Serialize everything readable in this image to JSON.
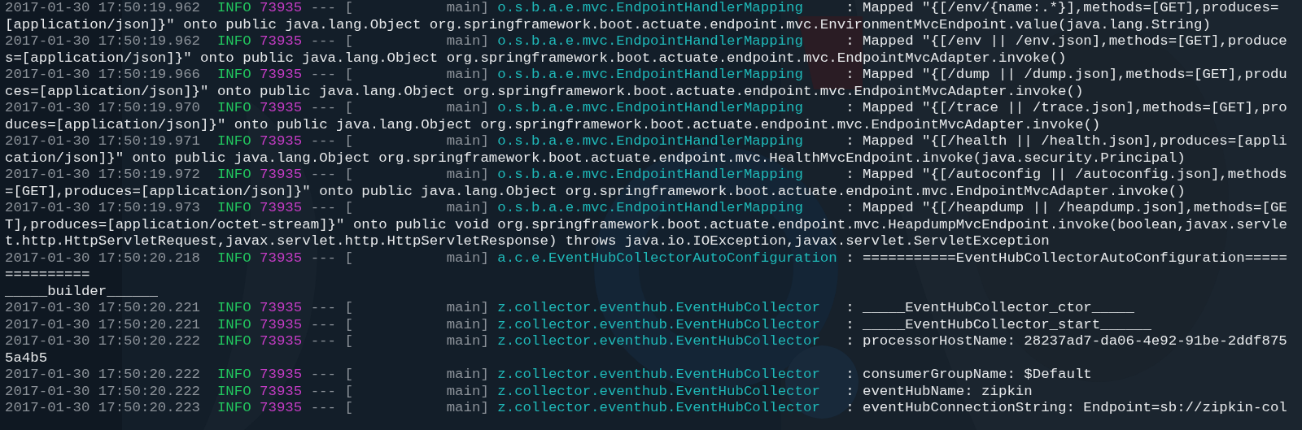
{
  "terminal": {
    "lines": [
      {
        "kind": "log",
        "timestamp": "2017-01-30 17:50:19.962",
        "level": "INFO",
        "pid": "73935",
        "thread": "--- [           main]",
        "logger": "o.s.b.a.e.mvc.EndpointHandlerMapping",
        "message": ": Mapped \"{[/env/{name:.*}],methods=[GET],produces=[application/json]}\" onto public java.lang.Object org.springframework.boot.actuate.endpoint.mvc.EnvironmentMvcEndpoint.value(java.lang.String)"
      },
      {
        "kind": "log",
        "timestamp": "2017-01-30 17:50:19.962",
        "level": "INFO",
        "pid": "73935",
        "thread": "--- [           main]",
        "logger": "o.s.b.a.e.mvc.EndpointHandlerMapping",
        "message": ": Mapped \"{[/env || /env.json],methods=[GET],produces=[application/json]}\" onto public java.lang.Object org.springframework.boot.actuate.endpoint.mvc.EndpointMvcAdapter.invoke()"
      },
      {
        "kind": "log",
        "timestamp": "2017-01-30 17:50:19.966",
        "level": "INFO",
        "pid": "73935",
        "thread": "--- [           main]",
        "logger": "o.s.b.a.e.mvc.EndpointHandlerMapping",
        "message": ": Mapped \"{[/dump || /dump.json],methods=[GET],produces=[application/json]}\" onto public java.lang.Object org.springframework.boot.actuate.endpoint.mvc.EndpointMvcAdapter.invoke()"
      },
      {
        "kind": "log",
        "timestamp": "2017-01-30 17:50:19.970",
        "level": "INFO",
        "pid": "73935",
        "thread": "--- [           main]",
        "logger": "o.s.b.a.e.mvc.EndpointHandlerMapping",
        "message": ": Mapped \"{[/trace || /trace.json],methods=[GET],produces=[application/json]}\" onto public java.lang.Object org.springframework.boot.actuate.endpoint.mvc.EndpointMvcAdapter.invoke()"
      },
      {
        "kind": "log",
        "timestamp": "2017-01-30 17:50:19.971",
        "level": "INFO",
        "pid": "73935",
        "thread": "--- [           main]",
        "logger": "o.s.b.a.e.mvc.EndpointHandlerMapping",
        "message": ": Mapped \"{[/health || /health.json],produces=[application/json]}\" onto public java.lang.Object org.springframework.boot.actuate.endpoint.mvc.HealthMvcEndpoint.invoke(java.security.Principal)"
      },
      {
        "kind": "log",
        "timestamp": "2017-01-30 17:50:19.972",
        "level": "INFO",
        "pid": "73935",
        "thread": "--- [           main]",
        "logger": "o.s.b.a.e.mvc.EndpointHandlerMapping",
        "message": ": Mapped \"{[/autoconfig || /autoconfig.json],methods=[GET],produces=[application/json]}\" onto public java.lang.Object org.springframework.boot.actuate.endpoint.mvc.EndpointMvcAdapter.invoke()"
      },
      {
        "kind": "log",
        "timestamp": "2017-01-30 17:50:19.973",
        "level": "INFO",
        "pid": "73935",
        "thread": "--- [           main]",
        "logger": "o.s.b.a.e.mvc.EndpointHandlerMapping",
        "message": ": Mapped \"{[/heapdump || /heapdump.json],methods=[GET],produces=[application/octet-stream]}\" onto public void org.springframework.boot.actuate.endpoint.mvc.HeapdumpMvcEndpoint.invoke(boolean,javax.servlet.http.HttpServletRequest,javax.servlet.http.HttpServletResponse) throws java.io.IOException,javax.servlet.ServletException"
      },
      {
        "kind": "log",
        "timestamp": "2017-01-30 17:50:20.218",
        "level": "INFO",
        "pid": "73935",
        "thread": "--- [           main]",
        "logger": "a.c.e.EventHubCollectorAutoConfiguration",
        "message": ": ===========EventHubCollectorAutoConfiguration==============="
      },
      {
        "kind": "plain",
        "text": "_____builder______"
      },
      {
        "kind": "log",
        "timestamp": "2017-01-30 17:50:20.221",
        "level": "INFO",
        "pid": "73935",
        "thread": "--- [           main]",
        "logger": "z.collector.eventhub.EventHubCollector",
        "message": ": _____EventHubCollector_ctor_____"
      },
      {
        "kind": "log",
        "timestamp": "2017-01-30 17:50:20.221",
        "level": "INFO",
        "pid": "73935",
        "thread": "--- [           main]",
        "logger": "z.collector.eventhub.EventHubCollector",
        "message": ": _____EventHubCollector_start______"
      },
      {
        "kind": "log",
        "timestamp": "2017-01-30 17:50:20.222",
        "level": "INFO",
        "pid": "73935",
        "thread": "--- [           main]",
        "logger": "z.collector.eventhub.EventHubCollector",
        "message": ": processorHostName: 28237ad7-da06-4e92-91be-2ddf8755a4b5"
      },
      {
        "kind": "log",
        "timestamp": "2017-01-30 17:50:20.222",
        "level": "INFO",
        "pid": "73935",
        "thread": "--- [           main]",
        "logger": "z.collector.eventhub.EventHubCollector",
        "message": ": consumerGroupName: $Default"
      },
      {
        "kind": "log",
        "timestamp": "2017-01-30 17:50:20.222",
        "level": "INFO",
        "pid": "73935",
        "thread": "--- [           main]",
        "logger": "z.collector.eventhub.EventHubCollector",
        "message": ": eventHubName: zipkin"
      },
      {
        "kind": "log",
        "timestamp": "2017-01-30 17:50:20.223",
        "level": "INFO",
        "pid": "73935",
        "thread": "--- [           main]",
        "logger": "z.collector.eventhub.EventHubCollector",
        "message": ": eventHubConnectionString: Endpoint=sb://zipkin-col"
      }
    ]
  }
}
